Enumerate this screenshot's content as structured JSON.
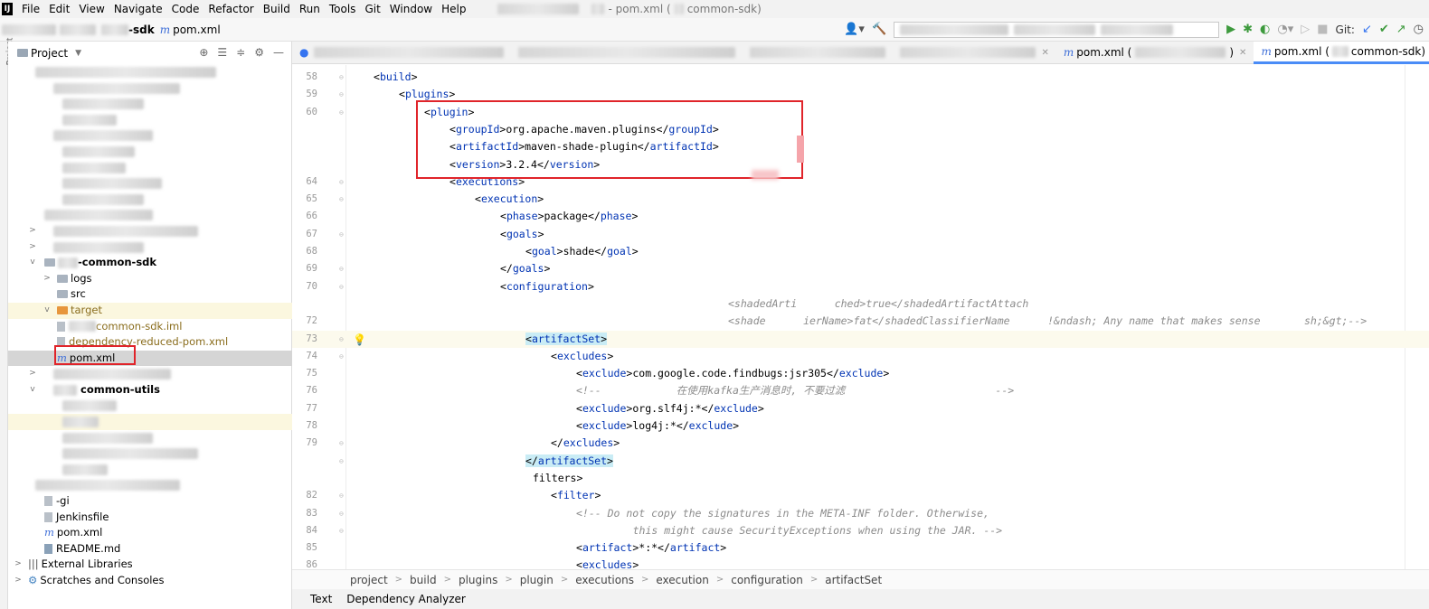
{
  "menu": {
    "items": [
      "File",
      "Edit",
      "View",
      "Navigate",
      "Code",
      "Refactor",
      "Build",
      "Run",
      "Tools",
      "Git",
      "Window",
      "Help"
    ],
    "window_title_mid": "- pom.xml (",
    "window_title_end": "common-sdk)"
  },
  "toolbar": {
    "crumb_project": "-sdk",
    "crumb_file": "pom.xml",
    "git_label": "Git:"
  },
  "project": {
    "header_title": "Project",
    "tree": {
      "common_sdk": "-common-sdk",
      "logs": "logs",
      "src": "src",
      "target": "target",
      "iml": "common-sdk.iml",
      "reduced_pom": "dependency-reduced-pom.xml",
      "pom_selected": "pom.xml",
      "common_utils": "common-utils",
      "gitig": "-gi",
      "jenkinsfile": "Jenkinsfile",
      "pom_root": "pom.xml",
      "readme": "README.md",
      "external_libs": "External Libraries",
      "scratches": "Scratches and Consoles"
    }
  },
  "tabs": {
    "tab1_label": "pom.xml (",
    "tab1_suffix": ")",
    "tab2_label": "pom.xml (",
    "tab2_suffix": "common-sdk)"
  },
  "editor": {
    "lines": [
      {
        "n": "58",
        "code": "<build>"
      },
      {
        "n": "59",
        "code": "<plugins>"
      },
      {
        "n": "60",
        "code": "<plugin>"
      },
      {
        "n": "",
        "code": "<groupId>org.apache.maven.plugins</groupId>"
      },
      {
        "n": "",
        "code": "<artifactId>maven-shade-plugin</artifactId>"
      },
      {
        "n": "",
        "code": "<version>3.2.4</version>"
      },
      {
        "n": "64",
        "code": "<executions>"
      },
      {
        "n": "65",
        "code": "<execution>"
      },
      {
        "n": "66",
        "code": "<phase>package</phase>"
      },
      {
        "n": "67",
        "code": "<goals>"
      },
      {
        "n": "68",
        "code": "<goal>shade</goal>"
      },
      {
        "n": "69",
        "code": "</goals>"
      },
      {
        "n": "70",
        "code": "<configuration>"
      },
      {
        "n": "",
        "code": "<shadedArti      ched>true</shadedArtifactAttach"
      },
      {
        "n": "72",
        "code": "<shade      ierName>fat</shadedClassifierName      !&ndash; Any name that makes sense       sh;&gt;-->"
      },
      {
        "n": "73",
        "code": "<artifactSet>"
      },
      {
        "n": "74",
        "code": "<excludes>"
      },
      {
        "n": "75",
        "code": "<exclude>com.google.code.findbugs:jsr305</exclude>"
      },
      {
        "n": "76",
        "code": "<!--            在使用kafka生产消息时, 不要过滤                        -->"
      },
      {
        "n": "77",
        "code": "<exclude>org.slf4j:*</exclude>"
      },
      {
        "n": "78",
        "code": "<exclude>log4j:*</exclude>"
      },
      {
        "n": "79",
        "code": "</excludes>"
      },
      {
        "n": "",
        "code": "</artifactSet>"
      },
      {
        "n": "",
        "code": "filters>"
      },
      {
        "n": "82",
        "code": "<filter>"
      },
      {
        "n": "83",
        "code": "<!-- Do not copy the signatures in the META-INF folder. Otherwise,"
      },
      {
        "n": "84",
        "code": "     this might cause SecurityExceptions when using the JAR. -->"
      },
      {
        "n": "85",
        "code": "<artifact>*:*</artifact>"
      },
      {
        "n": "86",
        "code": "<excludes>"
      }
    ]
  },
  "breadcrumbs": [
    "project",
    "build",
    "plugins",
    "plugin",
    "executions",
    "execution",
    "configuration",
    "artifactSet"
  ],
  "bottom_tabs": [
    "Text",
    "Dependency Analyzer"
  ],
  "colors": {
    "tag": "#0033b3",
    "comment": "#8c8c8c",
    "highlight": "#c9ecf5",
    "redbox": "#e0242a",
    "accent": "#4a8cf7"
  }
}
